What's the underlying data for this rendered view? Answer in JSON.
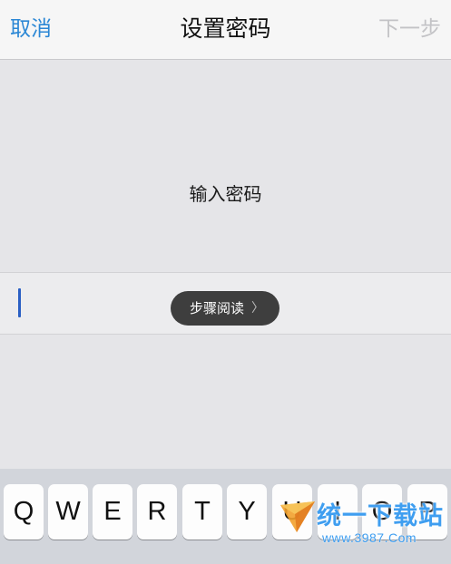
{
  "navbar": {
    "cancel_label": "取消",
    "title": "设置密码",
    "next_label": "下一步"
  },
  "prompt": {
    "text": "输入密码"
  },
  "password_field": {
    "value": ""
  },
  "pill": {
    "label": "步骤阅读",
    "chevron": "〉"
  },
  "keyboard": {
    "row1": [
      "Q",
      "W",
      "E",
      "R",
      "T",
      "Y",
      "U",
      "I",
      "O",
      "P"
    ]
  },
  "watermark": {
    "text": "统一下载站",
    "url": "www.3987.Com"
  },
  "colors": {
    "accent": "#2b87d5",
    "disabled": "#c3c3c6",
    "caret": "#2a5fc4",
    "pill_bg": "#3e3e3e",
    "watermark": "#3f9ef0"
  }
}
